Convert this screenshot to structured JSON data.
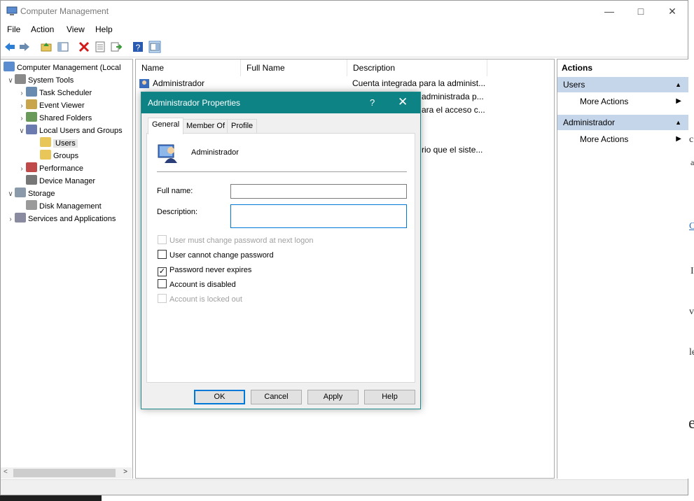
{
  "window": {
    "title": "Computer Management"
  },
  "menu": [
    "File",
    "Action",
    "View",
    "Help"
  ],
  "tree": {
    "items": [
      {
        "label": "Computer Management (Local",
        "level": 0,
        "chev": ""
      },
      {
        "label": "System Tools",
        "level": 1,
        "chev": "v"
      },
      {
        "label": "Task Scheduler",
        "level": 2,
        "chev": ">"
      },
      {
        "label": "Event Viewer",
        "level": 2,
        "chev": ">"
      },
      {
        "label": "Shared Folders",
        "level": 2,
        "chev": ">"
      },
      {
        "label": "Local Users and Groups",
        "level": 2,
        "chev": "v"
      },
      {
        "label": "Users",
        "level": 3,
        "chev": ""
      },
      {
        "label": "Groups",
        "level": 3,
        "chev": ""
      },
      {
        "label": "Performance",
        "level": 2,
        "chev": ">"
      },
      {
        "label": "Device Manager",
        "level": 2,
        "chev": ""
      },
      {
        "label": "Storage",
        "level": 1,
        "chev": "v"
      },
      {
        "label": "Disk Management",
        "level": 2,
        "chev": ""
      },
      {
        "label": "Services and Applications",
        "level": 1,
        "chev": ">"
      }
    ]
  },
  "list": {
    "columns": [
      "Name",
      "Full Name",
      "Description"
    ],
    "rows": [
      {
        "name": "Administrador",
        "desc": "Cuenta integrada para la administ..."
      },
      {
        "name": "",
        "desc": "administrada p..."
      },
      {
        "name": "",
        "desc": "ara el acceso c..."
      },
      {
        "name": "",
        "desc": ""
      },
      {
        "name": "",
        "desc": "rio que el siste..."
      }
    ]
  },
  "actions": {
    "header": "Actions",
    "sections": [
      {
        "title": "Users",
        "item": "More Actions"
      },
      {
        "title": "Administrador",
        "item": "More Actions"
      }
    ]
  },
  "dialog": {
    "title": "Administrador Properties",
    "help": "?",
    "close": "✕",
    "tabs": [
      "General",
      "Member Of",
      "Profile"
    ],
    "username": "Administrador",
    "fullname_label": "Full name:",
    "fullname_value": "",
    "description_label": "Description:",
    "description_value": "",
    "checkboxes": [
      {
        "label": "User must change password at next logon",
        "checked": false,
        "disabled": true
      },
      {
        "label": "User cannot change password",
        "checked": false,
        "disabled": false
      },
      {
        "label": "Password never expires",
        "checked": true,
        "disabled": false
      },
      {
        "label": "Account is disabled",
        "checked": false,
        "disabled": false
      },
      {
        "label": "Account is locked out",
        "checked": false,
        "disabled": true
      }
    ],
    "buttons": [
      "OK",
      "Cancel",
      "Apply",
      "Help"
    ]
  }
}
